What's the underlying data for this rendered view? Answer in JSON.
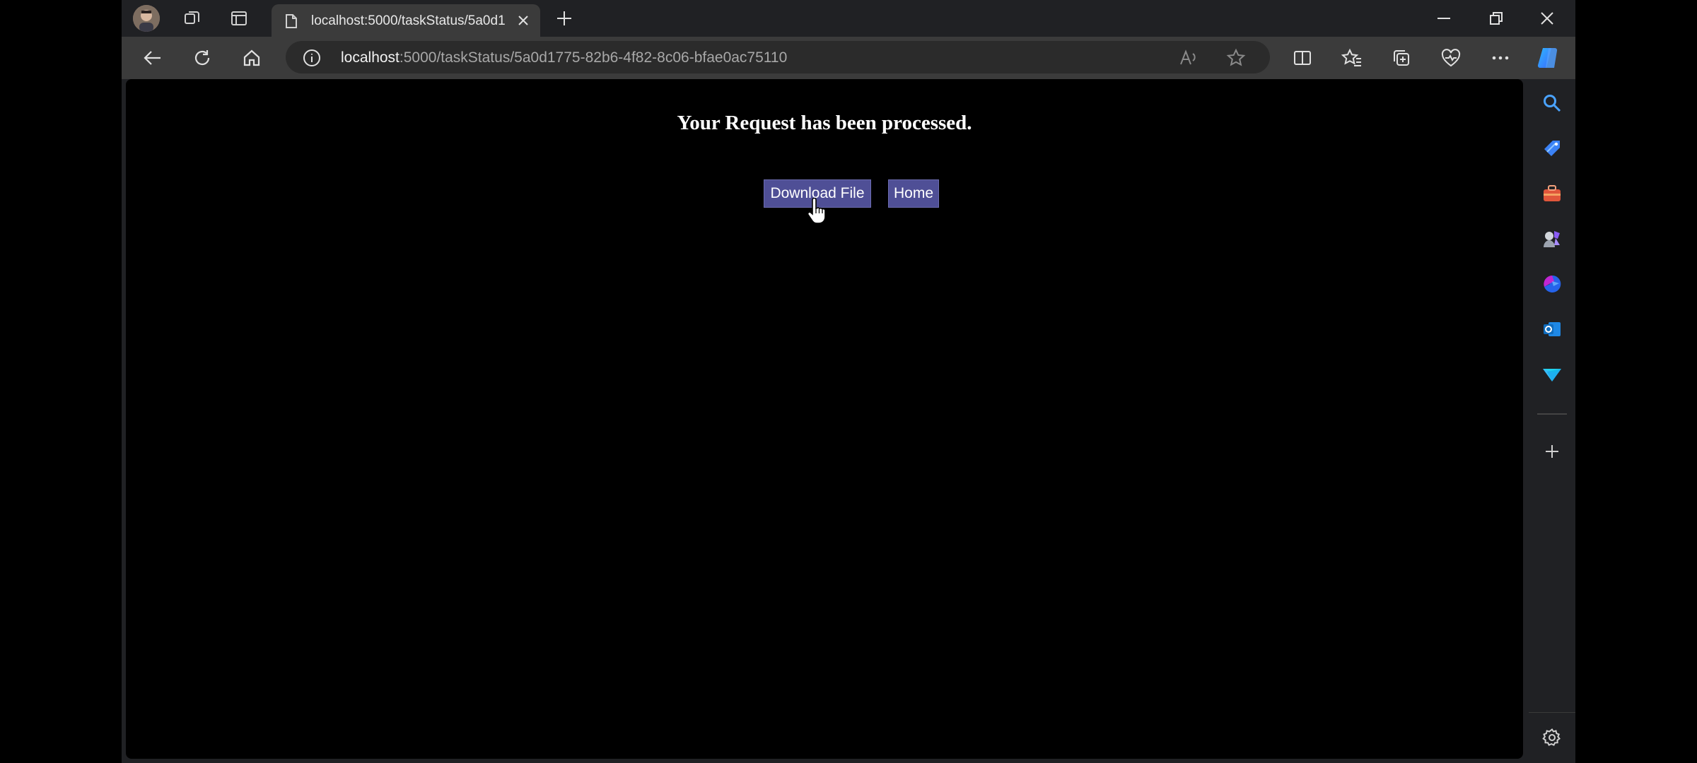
{
  "browser": {
    "tab": {
      "title": "localhost:5000/taskStatus/5a0d1"
    },
    "address": {
      "host": "localhost",
      "path": ":5000/taskStatus/5a0d1775-82b6-4f82-8c06-bfae0ac75110"
    }
  },
  "page": {
    "heading": "Your Request has been processed.",
    "download_button": "Download File",
    "home_button": "Home"
  },
  "colors": {
    "button_bg": "#4f4f96",
    "page_bg": "#000000",
    "chrome_bg": "#202124",
    "toolbar_bg": "#3b3b3b"
  }
}
